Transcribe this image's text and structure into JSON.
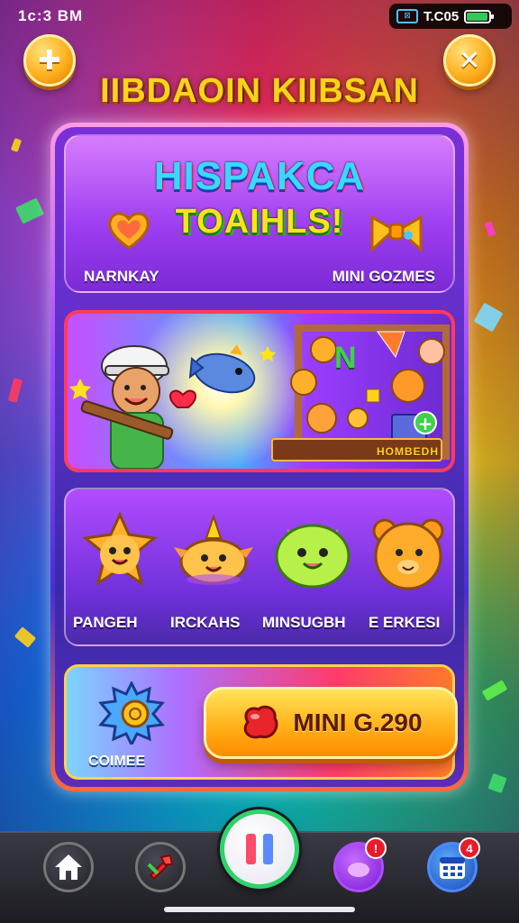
{
  "status_bar": {
    "time": "1c:3 BM",
    "network": "⊠",
    "clock": "T.C05",
    "battery_level": 0.95
  },
  "top_buttons": {
    "left_icon": "puzzle-icon",
    "right_icon": "close-icon",
    "left_glyph": "✚",
    "right_glyph": "✕"
  },
  "game_title": "IIBDAOIN KIIBSAN",
  "header_card": {
    "title_line1": "HISPAKCA",
    "title_line2": "TOAIHLS!",
    "left_label": "NARNKAY",
    "right_label": "MINI GOZMES"
  },
  "scene_card": {
    "stage_letter": "N",
    "stage_label": "HOMBEDH",
    "plus_glyph": "+"
  },
  "characters": [
    {
      "label": "PANGEH",
      "color": "#ffb02a",
      "icon": "star-creature-icon"
    },
    {
      "label": "IRCKAHS",
      "color": "#ff9a3a",
      "icon": "horn-creature-icon"
    },
    {
      "label": "MINSUGBH",
      "color": "#b8f04a",
      "icon": "lime-creature-icon"
    },
    {
      "label": "E ERKESI",
      "color": "#ff9a1a",
      "icon": "bear-creature-icon"
    }
  ],
  "bottom_card": {
    "coin_label": "COIMEE",
    "play_label": "MINI G.290"
  },
  "bottom_nav": {
    "items": [
      {
        "name": "home",
        "icon": "home-icon"
      },
      {
        "name": "tools",
        "icon": "hammer-icon"
      },
      {
        "name": "center",
        "icon": "pause-icon"
      },
      {
        "name": "games",
        "icon": "gamepad-icon",
        "badge": "!"
      },
      {
        "name": "calendar",
        "icon": "calendar-icon",
        "badge": "4"
      }
    ]
  },
  "colors": {
    "title_gold": "#ffd21a",
    "accent_orange": "#ffb21a",
    "nav_center_ring": "#2fd36a",
    "badge_red": "#e81c2a"
  }
}
